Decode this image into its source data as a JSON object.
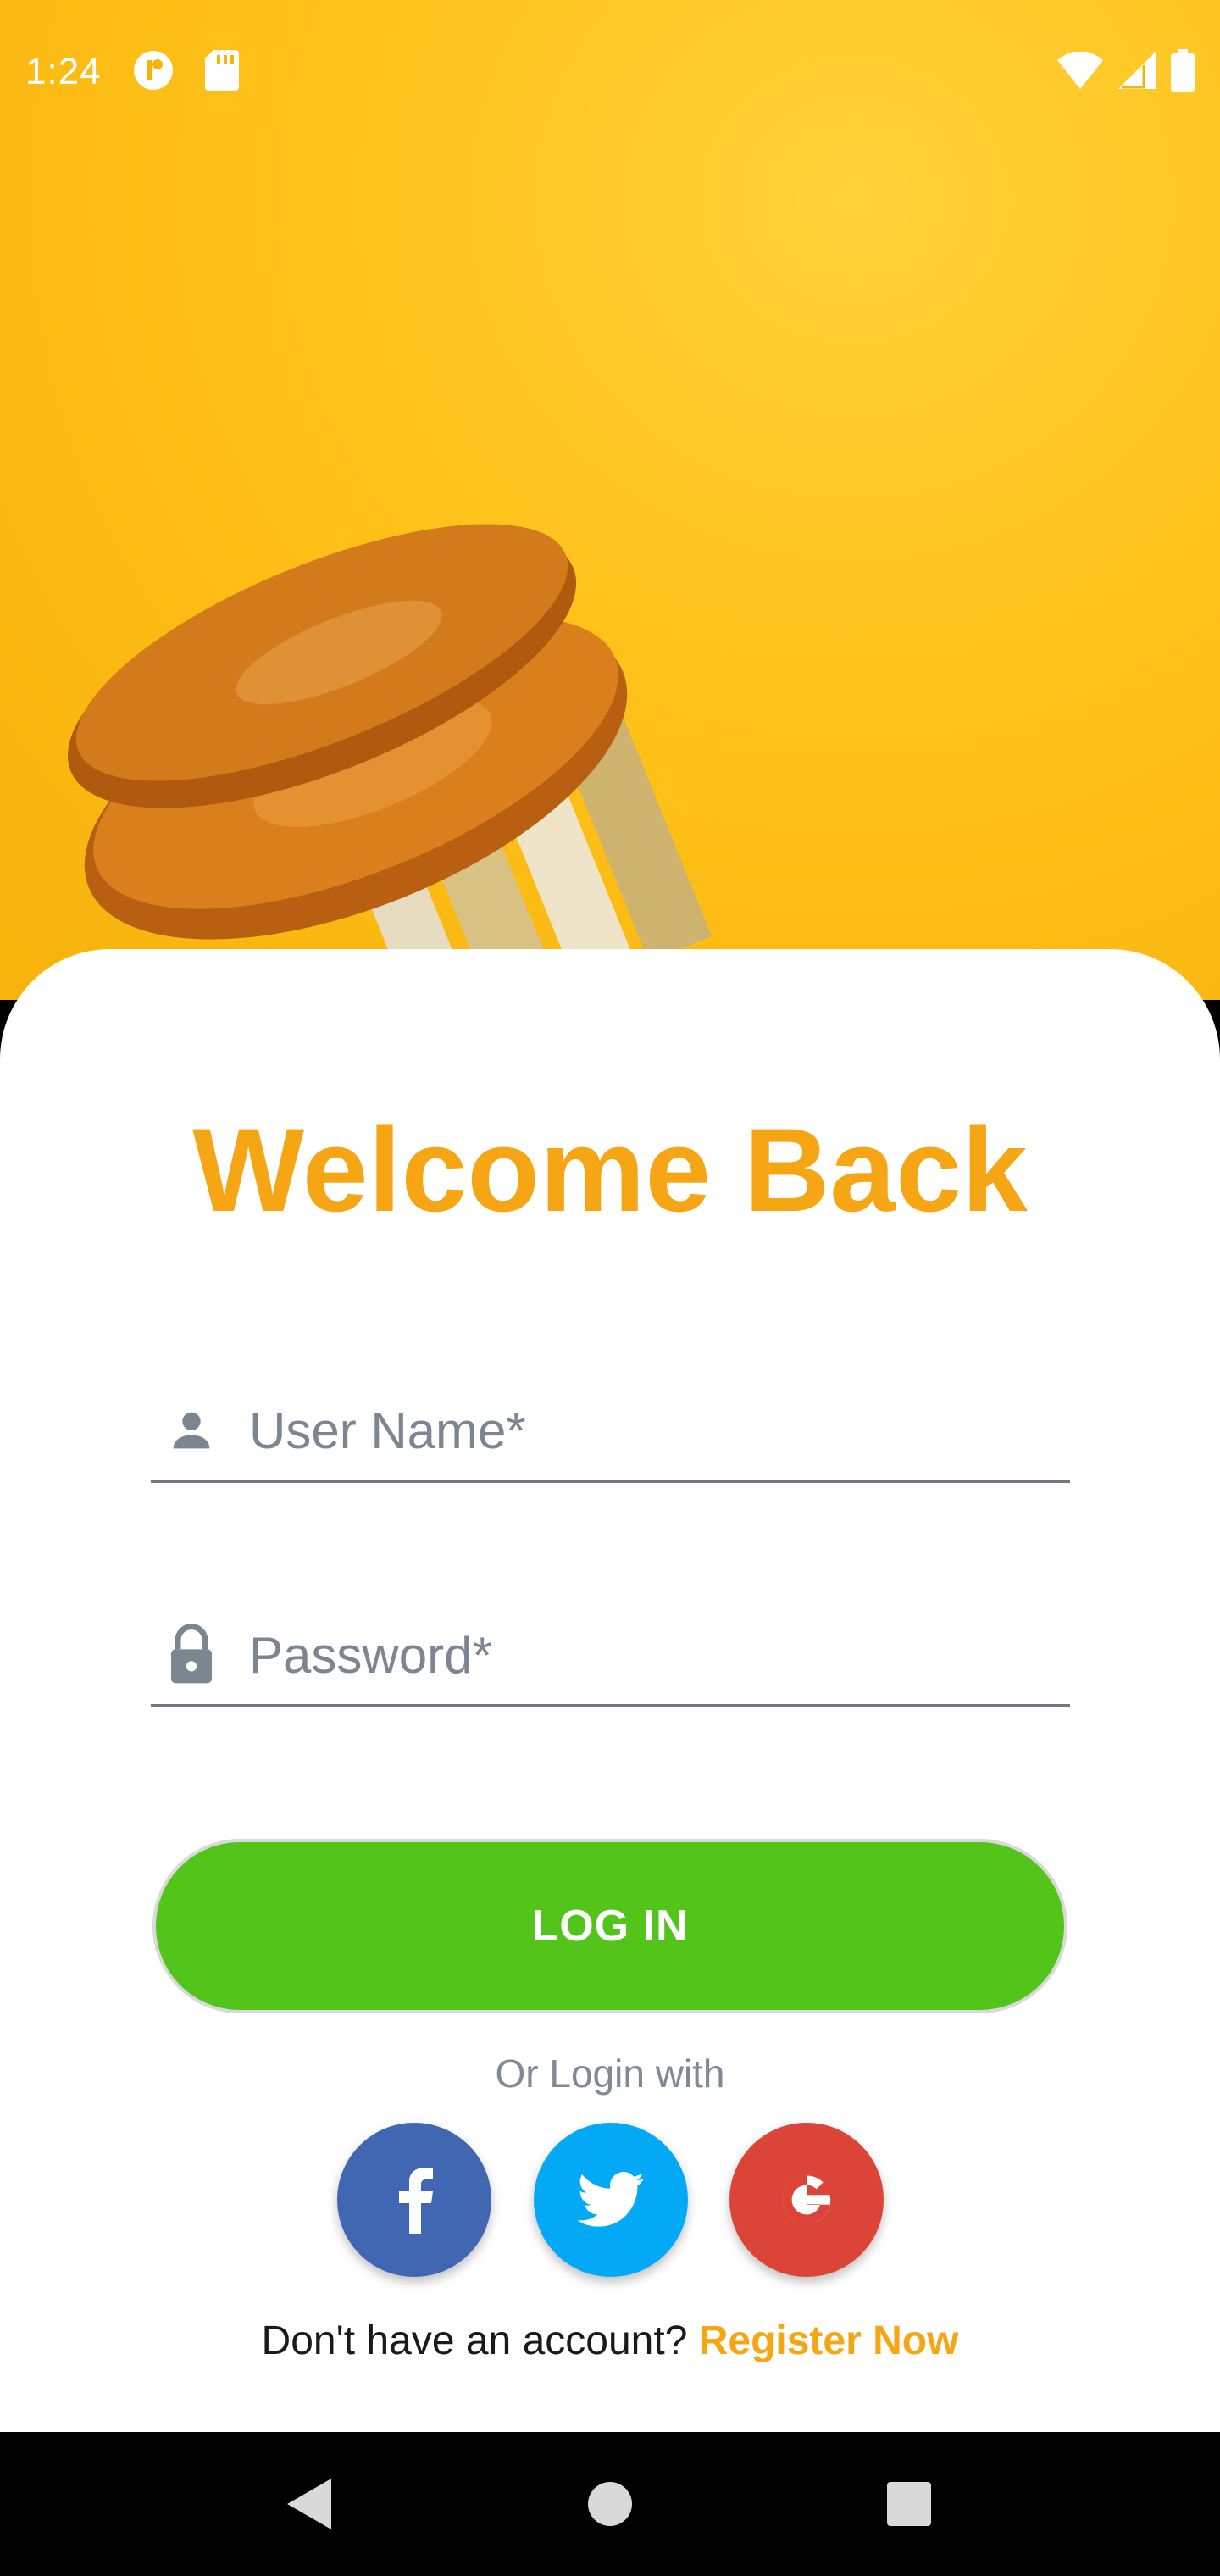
{
  "status_bar": {
    "time": "1:24",
    "icons": [
      "notification-badge-icon",
      "sd-card-icon",
      "wifi-icon",
      "signal-icon",
      "battery-icon"
    ]
  },
  "hero": {
    "image": "donut-stack-on-yellow"
  },
  "login": {
    "title": "Welcome Back",
    "username_placeholder": "User Name*",
    "password_placeholder": "Password*",
    "login_label": "LOG IN",
    "or_text": "Or Login with",
    "social": [
      "facebook-icon",
      "twitter-icon",
      "google-icon"
    ],
    "no_account_text": "Don't have an account? ",
    "register_label": "Register Now"
  },
  "nav": {
    "icons": [
      "back-icon",
      "home-icon",
      "recents-icon"
    ]
  },
  "colors": {
    "accent": "#f6a515",
    "login_button": "#52c41a",
    "facebook": "#4267b2",
    "twitter": "#03a9f4",
    "google": "#db4437",
    "hero_bg": "#ffc21a"
  }
}
